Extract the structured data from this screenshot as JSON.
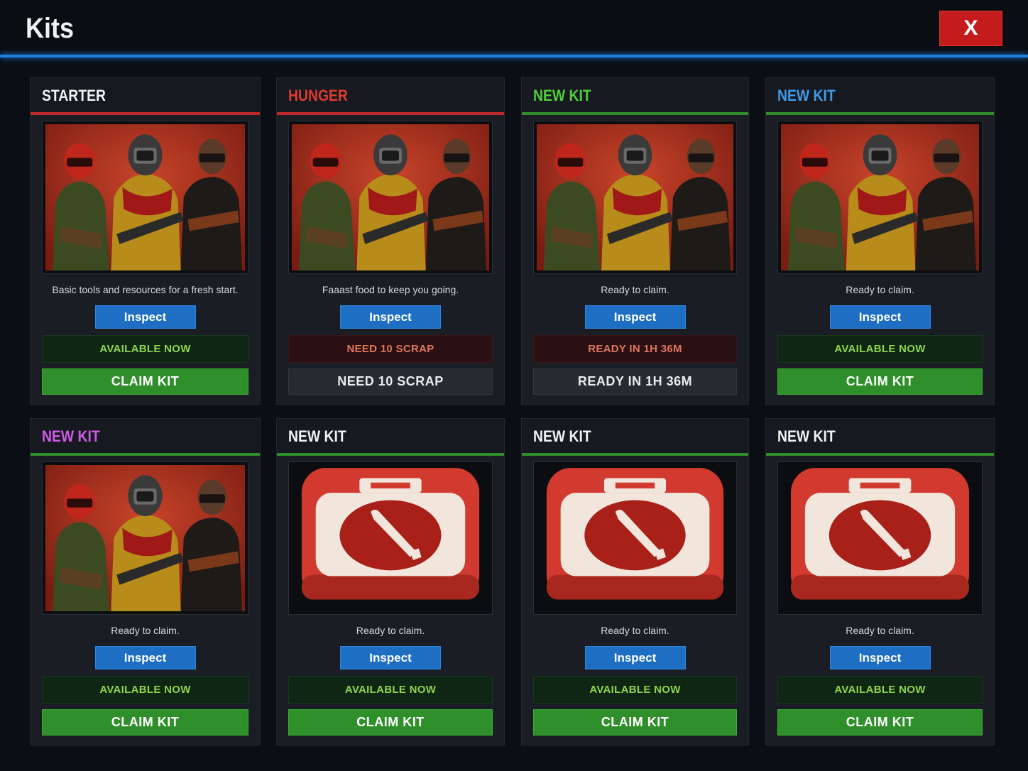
{
  "header": {
    "title": "Kits",
    "close_label": "X",
    "accent_color": "#1d7fe0"
  },
  "kits": [
    {
      "title": "STARTER",
      "title_color": "#f2f2f2",
      "accent_color": "#c0282a",
      "image": "soldiers-artwork",
      "description": "Basic tools and resources for a fresh start.",
      "inspect_label": "Inspect",
      "status": "AVAILABLE NOW",
      "status_type": "available",
      "action_label": "CLAIM KIT"
    },
    {
      "title": "HUNGER",
      "title_color": "#e03a2c",
      "accent_color": "#c0282a",
      "image": "soldiers-artwork",
      "description": "Faaast food to keep you going.",
      "inspect_label": "Inspect",
      "status": "NEED 10 SCRAP",
      "status_type": "locked",
      "action_label": "NEED 10 SCRAP"
    },
    {
      "title": "NEW KIT",
      "title_color": "#4fcf3a",
      "accent_color": "#2f8f2a",
      "image": "soldiers-artwork",
      "description": "Ready to claim.",
      "inspect_label": "Inspect",
      "status": "READY IN 1H 36M",
      "status_type": "locked",
      "action_label": "READY IN 1H 36M"
    },
    {
      "title": "NEW KIT",
      "title_color": "#3d9be8",
      "accent_color": "#2f8f2a",
      "image": "soldiers-artwork",
      "description": "Ready to claim.",
      "inspect_label": "Inspect",
      "status": "AVAILABLE NOW",
      "status_type": "available",
      "action_label": "CLAIM KIT"
    },
    {
      "title": "NEW KIT",
      "title_color": "#d05ae8",
      "accent_color": "#2f8f2a",
      "image": "soldiers-artwork",
      "description": "Ready to claim.",
      "inspect_label": "Inspect",
      "status": "AVAILABLE NOW",
      "status_type": "available",
      "action_label": "CLAIM KIT"
    },
    {
      "title": "NEW KIT",
      "title_color": "#f2f2f2",
      "accent_color": "#2f8f2a",
      "image": "ammo-case-icon",
      "description": "Ready to claim.",
      "inspect_label": "Inspect",
      "status": "AVAILABLE NOW",
      "status_type": "available",
      "action_label": "CLAIM KIT"
    },
    {
      "title": "NEW KIT",
      "title_color": "#f2f2f2",
      "accent_color": "#2f8f2a",
      "image": "ammo-case-icon",
      "description": "Ready to claim.",
      "inspect_label": "Inspect",
      "status": "AVAILABLE NOW",
      "status_type": "available",
      "action_label": "CLAIM KIT"
    },
    {
      "title": "NEW KIT",
      "title_color": "#f2f2f2",
      "accent_color": "#2f8f2a",
      "image": "ammo-case-icon",
      "description": "Ready to claim.",
      "inspect_label": "Inspect",
      "status": "AVAILABLE NOW",
      "status_type": "available",
      "action_label": "CLAIM KIT"
    }
  ]
}
